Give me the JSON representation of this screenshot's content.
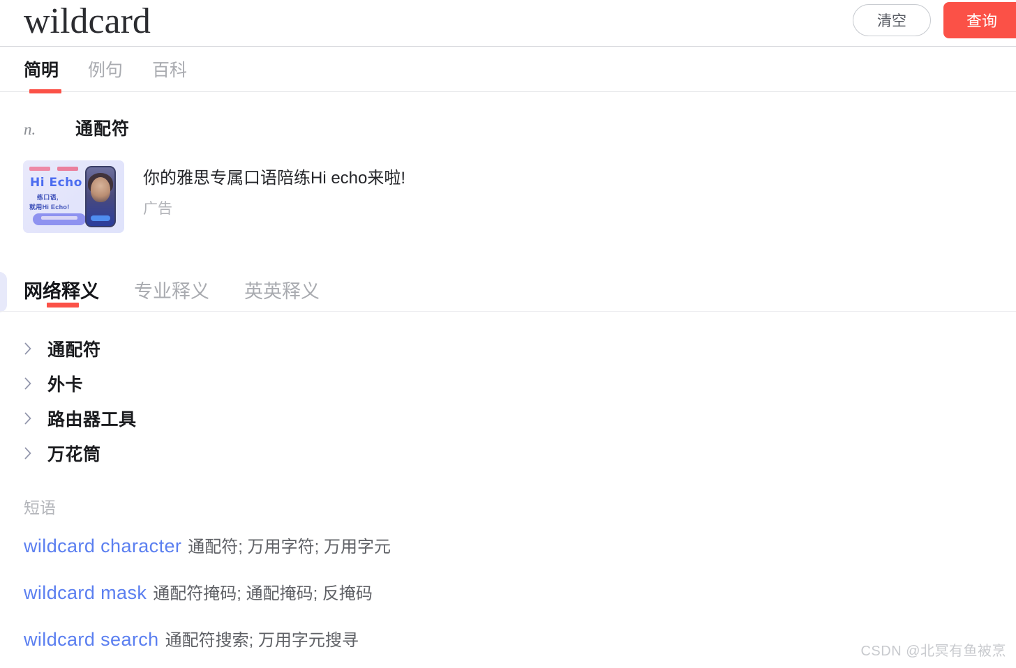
{
  "header": {
    "word": "wildcard",
    "clear_button": "清空",
    "search_button": "查询"
  },
  "primary_tabs": [
    {
      "label": "简明",
      "active": true
    },
    {
      "label": "例句",
      "active": false
    },
    {
      "label": "百科",
      "active": false
    }
  ],
  "definition": {
    "part_of_speech": "n.",
    "meaning": "通配符"
  },
  "ad": {
    "title": "你的雅思专属口语陪练Hi echo来啦!",
    "label": "广告",
    "thumb": {
      "brand": "Hi Echo",
      "line1": "练口语,",
      "line2": "就用Hi Echo!"
    }
  },
  "secondary_tabs": [
    {
      "label": "网络释义",
      "active": true
    },
    {
      "label": "专业释义",
      "active": false
    },
    {
      "label": "英英释义",
      "active": false
    }
  ],
  "net_definitions": [
    {
      "label": "通配符"
    },
    {
      "label": "外卡"
    },
    {
      "label": "路由器工具"
    },
    {
      "label": "万花筒"
    }
  ],
  "phrases": {
    "heading": "短语",
    "items": [
      {
        "en": "wildcard character",
        "cn": "通配符; 万用字符; 万用字元"
      },
      {
        "en": "wildcard mask",
        "cn": "通配符掩码; 通配掩码; 反掩码"
      },
      {
        "en": "wildcard search",
        "cn": "通配符搜索; 万用字元搜寻"
      }
    ]
  },
  "watermark": "CSDN @北冥有鱼被烹",
  "colors": {
    "accent_red": "#fb5147",
    "link_blue": "#5b7ff0",
    "muted_gray": "#a9abb0"
  }
}
